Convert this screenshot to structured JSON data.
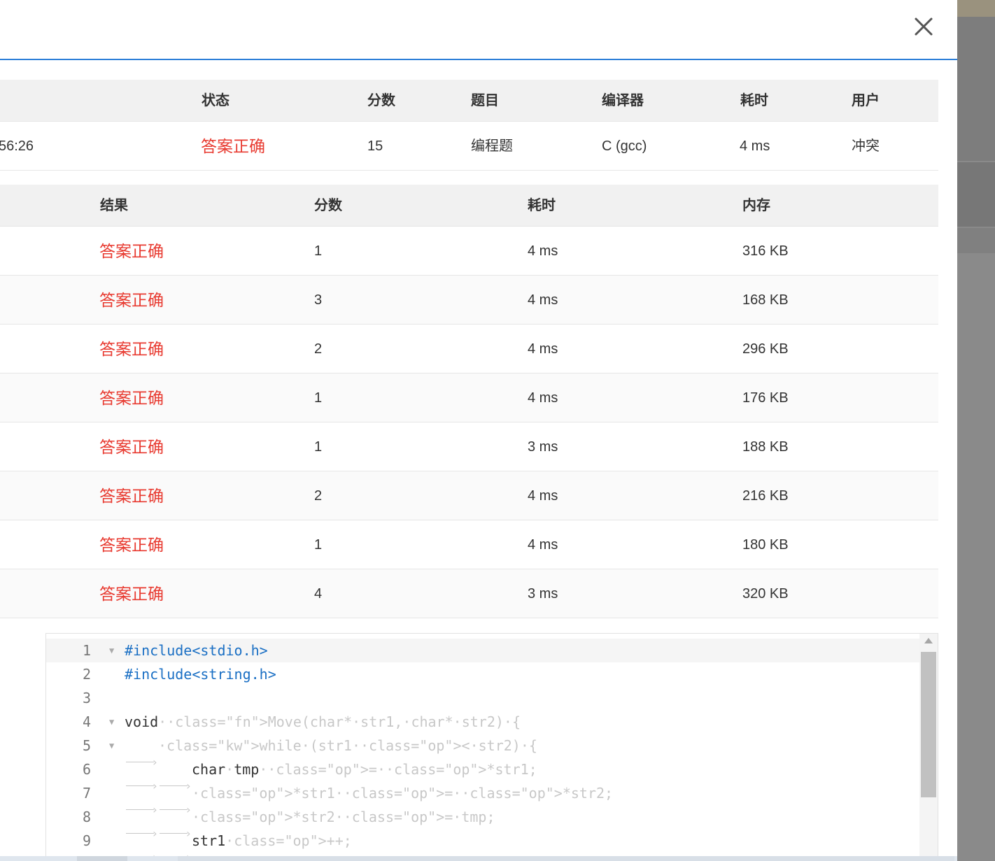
{
  "dialog": {
    "close_label": "close"
  },
  "summary": {
    "headers": [
      "状态",
      "分数",
      "题目",
      "编译器",
      "耗时",
      "用户"
    ],
    "row": {
      "time_fragment": "56:26",
      "status": "答案正确",
      "score": "15",
      "problem": "编程题",
      "compiler": "C (gcc)",
      "elapsed": "4 ms",
      "user": "冲突"
    }
  },
  "cases": {
    "headers": [
      "结果",
      "分数",
      "耗时",
      "内存"
    ],
    "rows": [
      {
        "result": "答案正确",
        "score": "1",
        "time": "4 ms",
        "memory": "316 KB"
      },
      {
        "result": "答案正确",
        "score": "3",
        "time": "4 ms",
        "memory": "168 KB"
      },
      {
        "result": "答案正确",
        "score": "2",
        "time": "4 ms",
        "memory": "296 KB"
      },
      {
        "result": "答案正确",
        "score": "1",
        "time": "4 ms",
        "memory": "176 KB"
      },
      {
        "result": "答案正确",
        "score": "1",
        "time": "3 ms",
        "memory": "188 KB"
      },
      {
        "result": "答案正确",
        "score": "2",
        "time": "4 ms",
        "memory": "216 KB"
      },
      {
        "result": "答案正确",
        "score": "1",
        "time": "4 ms",
        "memory": "180 KB"
      },
      {
        "result": "答案正确",
        "score": "4",
        "time": "3 ms",
        "memory": "320 KB"
      }
    ]
  },
  "code": {
    "line_numbers": [
      "1",
      "2",
      "3",
      "4",
      "5",
      "6",
      "7",
      "8",
      "9"
    ],
    "lines": [
      "#include<stdio.h>",
      "#include<string.h>",
      "",
      "void Move(char* str1, char* str2) {",
      "while (str1 < str2) {",
      "char tmp = *str1;",
      "*str1 = *str2;",
      "*str2 = tmp;",
      "str1++;"
    ]
  },
  "colors": {
    "accent": "#2d7fd8",
    "status_ok": "#e83a30",
    "header_bg": "#f1f1f1",
    "preprocessor": "#1a6fc4",
    "function": "#8d3fc1",
    "keyword": "#d4242c"
  },
  "icons": {
    "close": "close-icon",
    "fold": "fold-arrow-icon"
  }
}
